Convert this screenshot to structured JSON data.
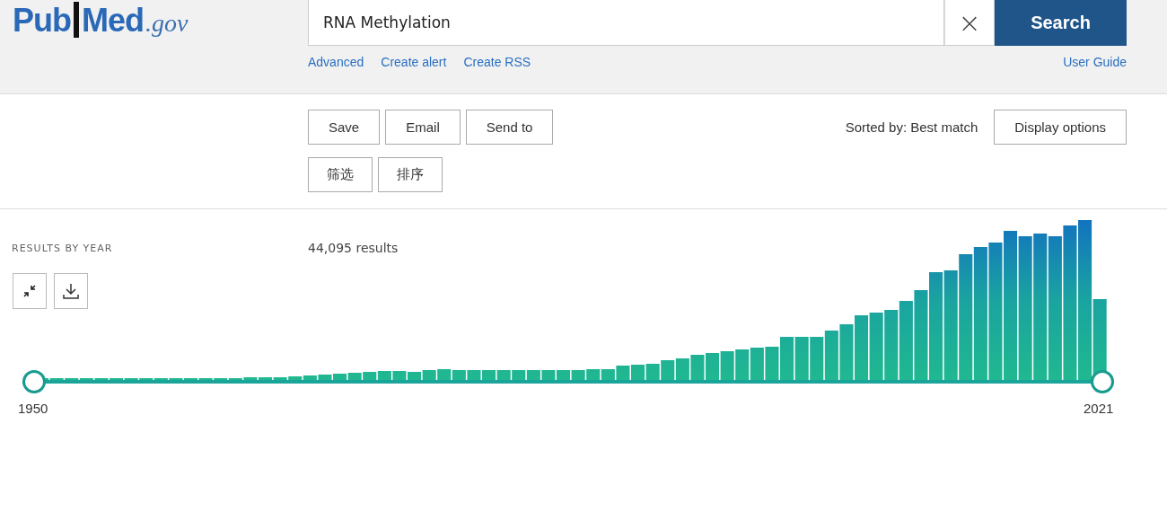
{
  "header": {
    "logo": {
      "main_left": "Pub",
      "main_right": "Med",
      "suffix": ".gov"
    },
    "search": {
      "value": "RNA Methylation",
      "clear": "×",
      "button": "Search"
    },
    "links": [
      "Advanced",
      "Create alert",
      "Create RSS"
    ],
    "user_guide": "User Guide"
  },
  "actions": {
    "row_1": [
      "Save",
      "Email",
      "Send to"
    ],
    "row_2": [
      "筛选",
      "排序"
    ],
    "sorted_by": "Sorted by: Best match",
    "display_options": "Display options"
  },
  "results": {
    "heading": "RESULTS BY YEAR",
    "count": "44,095 results",
    "timeline": {
      "start_label": "1950",
      "end_label": "2021",
      "handles": [
        {
          "level": 0
        },
        {
          "level": 1
        }
      ]
    }
  }
}
